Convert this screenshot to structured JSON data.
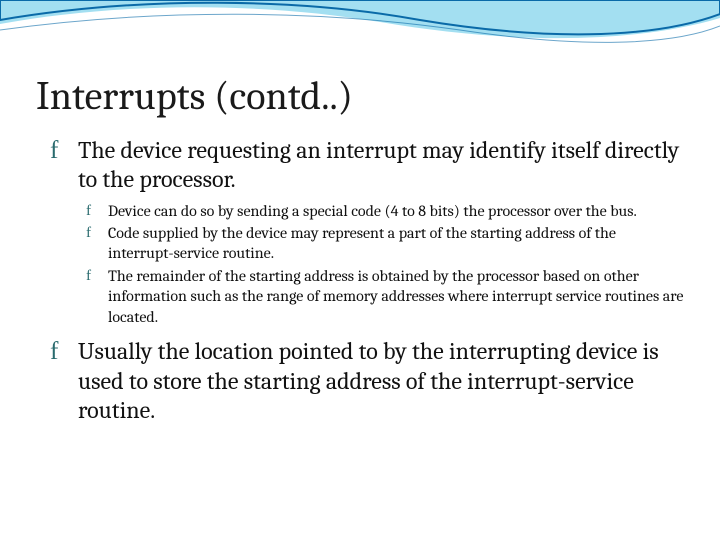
{
  "bullet_glyph_l1": "f",
  "bullet_glyph_l2": "f",
  "title": "Interrupts (contd..)",
  "bullets": [
    {
      "text": "The device requesting an interrupt may identify itself directly to the processor.",
      "sub": [
        "Device can do so by sending a special code (4 to 8 bits) the processor over the bus.",
        "Code supplied by the device may represent a part of the starting address of the interrupt-service routine.",
        "The remainder of the starting address is obtained by the processor based on other information such as the range of memory addresses where interrupt service routines are located."
      ]
    },
    {
      "text": "Usually the location pointed to by the interrupting device is used to store the starting address of the interrupt-service routine.",
      "sub": []
    }
  ],
  "colors": {
    "wave_dark": "#0a6aa8",
    "wave_light": "#58c5e6",
    "bullet_color": "#2a6b6e"
  }
}
